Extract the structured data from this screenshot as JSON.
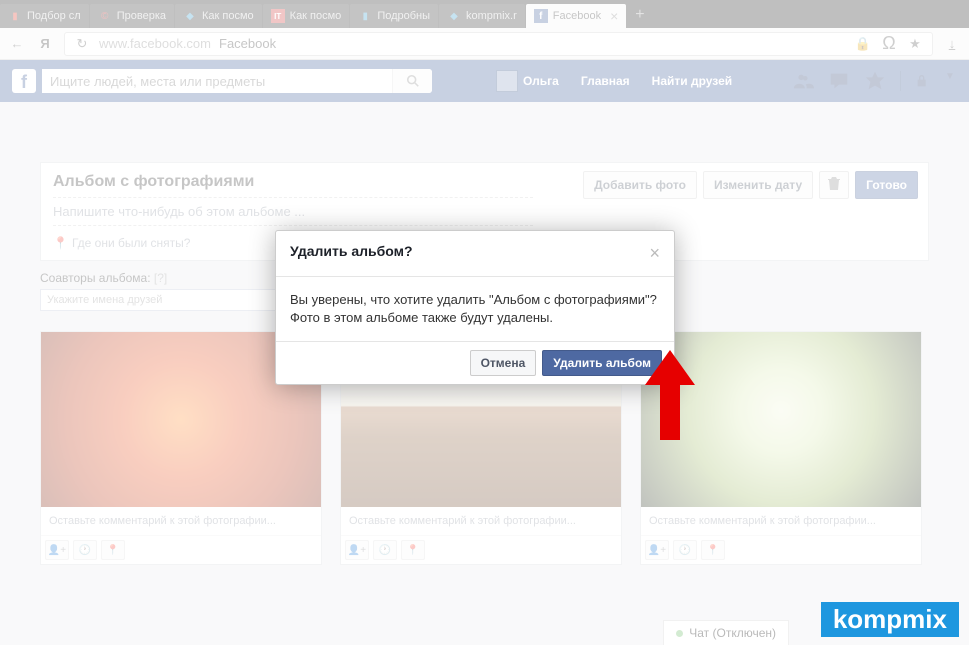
{
  "browser": {
    "tabs": [
      {
        "icon": "📊",
        "label": "Подбор сл",
        "color": "#d32"
      },
      {
        "icon": "©",
        "label": "Проверка",
        "color": "#c22"
      },
      {
        "icon": "◆",
        "label": "Как посмо",
        "color": "#39c"
      },
      {
        "icon": "IT",
        "label": "Как посмо",
        "color": "#c33"
      },
      {
        "icon": "▮",
        "label": "Подробны",
        "color": "#39c"
      },
      {
        "icon": "◆",
        "label": "kompmix.r",
        "color": "#39c"
      },
      {
        "icon": "f",
        "label": "Facebook",
        "color": "#3b5998",
        "active": true
      }
    ],
    "url": "www.facebook.com",
    "page_title": "Facebook"
  },
  "fb_header": {
    "search_placeholder": "Ищите людей, места или предметы",
    "user": "Ольга",
    "nav_home": "Главная",
    "nav_find_friends": "Найти друзей"
  },
  "album": {
    "title": "Альбом с фотографиями",
    "desc_placeholder": "Напишите что-нибудь об этом альбоме ...",
    "location_placeholder": "Где они были сняты?",
    "coauthors_label": "Соавторы альбома:",
    "coauthors_placeholder": "Укажите имена друзей",
    "btn_add_photo": "Добавить фото",
    "btn_change_date": "Изменить дату",
    "btn_done": "Готово"
  },
  "photos": {
    "comment_placeholder": "Оставьте комментарий к этой фотографии..."
  },
  "modal": {
    "title": "Удалить альбом?",
    "body_line1": "Вы уверены, что хотите удалить \"Альбом с фотографиями\"?",
    "body_line2": "Фото в этом альбоме также будут удалены.",
    "btn_cancel": "Отмена",
    "btn_confirm": "Удалить альбом"
  },
  "chat": {
    "label": "Чат (Отключен)"
  },
  "watermark": "kompmix"
}
